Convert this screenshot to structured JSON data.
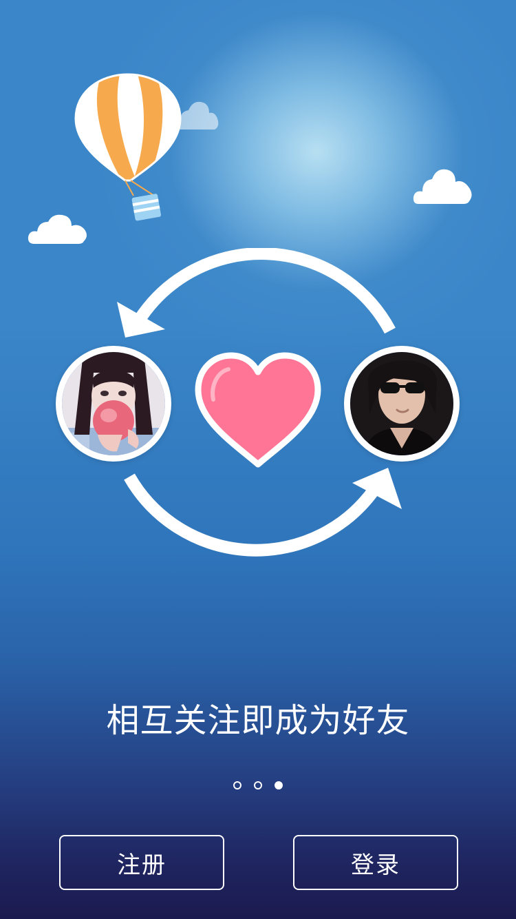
{
  "caption": "相互关注即成为好友",
  "buttons": {
    "register_label": "注册",
    "login_label": "登录"
  },
  "pagination": {
    "total": 3,
    "active_index": 2
  },
  "colors": {
    "heart": "#ff7595",
    "balloon_stripe": "#f7a94d",
    "basket": "#9fd3f3",
    "sky_top": "#3a86c8",
    "sky_bottom": "#1b1a4e"
  },
  "icons": [
    "cloud-icon",
    "hot-air-balloon-icon",
    "cycle-arrows-icon",
    "heart-icon"
  ]
}
